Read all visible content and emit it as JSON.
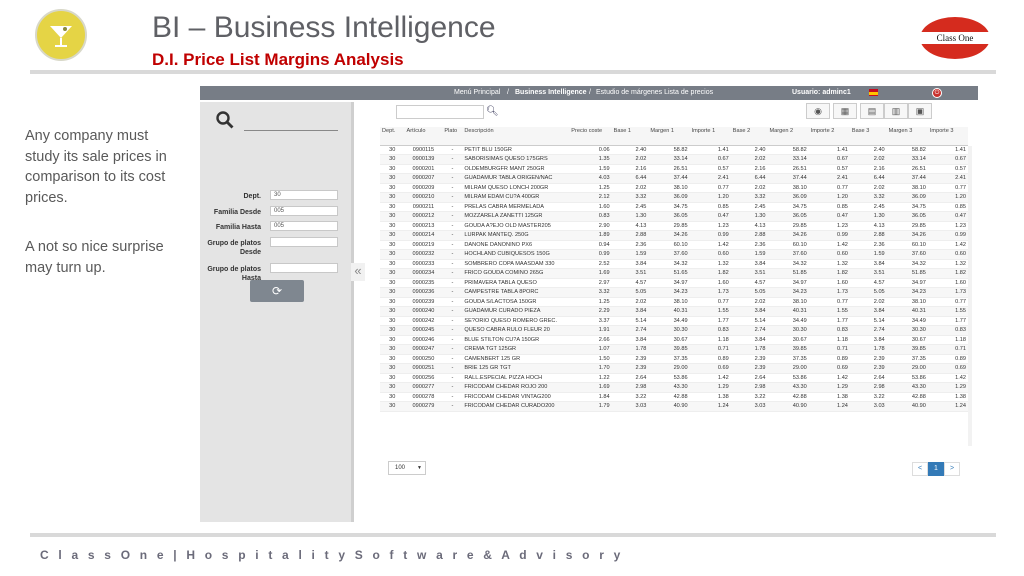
{
  "slide": {
    "title": "BI – Business Intelligence",
    "subtitle": "D.I. Price List Margins Analysis",
    "brand_right": "Class One",
    "side_para1": "Any company must study its sale prices in comparison to its cost prices.",
    "side_para2": "A not so nice surprise may turn up.",
    "footer": "C l a s s O n e | H o s p i t a l i t y S o f t w a r e & A d v i s o r y"
  },
  "app": {
    "breadcrumb": {
      "menu": "Menú Principal",
      "sep": "/",
      "bi": "Business Intelligence",
      "current": "Estudio de márgenes Lista de precios"
    },
    "user": "Usuario: adminc1",
    "filters": {
      "dept_label": "Dept.",
      "dept_value": "30",
      "familia_desde_label": "Familia Desde",
      "familia_desde_value": "005",
      "familia_hasta_label": "Familia Hasta",
      "familia_hasta_value": "005",
      "grupo_desde_label": "Grupo de platos Desde",
      "grupo_hasta_label": "Grupo de platos Hasta"
    },
    "columns": [
      "Dept.",
      "Artículo",
      "Plato",
      "Descripción",
      "Precio coste",
      "Base 1",
      "Margen 1",
      "Importe 1",
      "Base 2",
      "Margen 2",
      "Importe 2",
      "Base 3",
      "Margen 3",
      "Importe 3"
    ],
    "rows": [
      [
        "30",
        "0900115",
        "-",
        "PETIT BLU 150GR",
        "0.06",
        "2.40",
        "58.82",
        "1.41",
        "2.40",
        "58.82",
        "1.41",
        "2.40",
        "58.82",
        "1.41"
      ],
      [
        "30",
        "0900139",
        "-",
        "SABORISIMAS QUESO 175GRS",
        "1.35",
        "2.02",
        "33.14",
        "0.67",
        "2.02",
        "33.14",
        "0.67",
        "2.02",
        "33.14",
        "0.67"
      ],
      [
        "30",
        "0900201",
        "-",
        "OLDEMBURGFR MANT 250GR",
        "1.59",
        "2.16",
        "26.51",
        "0.57",
        "2.16",
        "26.51",
        "0.57",
        "2.16",
        "26.51",
        "0.57"
      ],
      [
        "30",
        "0900207",
        "-",
        "GUADAMUR TABLA ORIGEN/NAC",
        "4.03",
        "6.44",
        "37.44",
        "2.41",
        "6.44",
        "37.44",
        "2.41",
        "6.44",
        "37.44",
        "2.41"
      ],
      [
        "30",
        "0900209",
        "-",
        "MILRAM QUESO LONCH 200GR",
        "1.25",
        "2.02",
        "38.10",
        "0.77",
        "2.02",
        "38.10",
        "0.77",
        "2.02",
        "38.10",
        "0.77"
      ],
      [
        "30",
        "0900210",
        "-",
        "MILRAM EDAM CU?A 400GR",
        "2.12",
        "3.32",
        "36.09",
        "1.20",
        "3.32",
        "36.09",
        "1.20",
        "3.32",
        "36.09",
        "1.20"
      ],
      [
        "30",
        "0900211",
        "-",
        "PRELAS CABRA MERMELADA",
        "1.60",
        "2.45",
        "34.75",
        "0.85",
        "2.45",
        "34.75",
        "0.85",
        "2.45",
        "34.75",
        "0.85"
      ],
      [
        "30",
        "0900212",
        "-",
        "MOZZARELA ZANETTI 125GR",
        "0.83",
        "1.30",
        "36.05",
        "0.47",
        "1.30",
        "36.05",
        "0.47",
        "1.30",
        "36.05",
        "0.47"
      ],
      [
        "30",
        "0900213",
        "-",
        "GOUDA A?EJO OLD MASTER205",
        "2.90",
        "4.13",
        "29.85",
        "1.23",
        "4.13",
        "29.85",
        "1.23",
        "4.13",
        "29.85",
        "1.23"
      ],
      [
        "30",
        "0900214",
        "-",
        "LURPAK MANTEQ. 250G",
        "1.89",
        "2.88",
        "34.26",
        "0.99",
        "2.88",
        "34.26",
        "0.99",
        "2.88",
        "34.26",
        "0.99"
      ],
      [
        "30",
        "0900219",
        "-",
        "DANONE DANONINO PX6",
        "0.94",
        "2.36",
        "60.10",
        "1.42",
        "2.36",
        "60.10",
        "1.42",
        "2.36",
        "60.10",
        "1.42"
      ],
      [
        "30",
        "0900232",
        "-",
        "HOCHLAND CUBIQUESOS 150G",
        "0.99",
        "1.59",
        "37.60",
        "0.60",
        "1.59",
        "37.60",
        "0.60",
        "1.59",
        "37.60",
        "0.60"
      ],
      [
        "30",
        "0900233",
        "-",
        "SOMBRERO COPA MAASDAM 330",
        "2.52",
        "3.84",
        "34.32",
        "1.32",
        "3.84",
        "34.32",
        "1.32",
        "3.84",
        "34.32",
        "1.32"
      ],
      [
        "30",
        "0900234",
        "-",
        "FRICO GOUDA COMINO 265G",
        "1.69",
        "3.51",
        "51.65",
        "1.82",
        "3.51",
        "51.85",
        "1.82",
        "3.51",
        "51.85",
        "1.82"
      ],
      [
        "30",
        "0900235",
        "-",
        "PRIMAVERA TABLA QUESO",
        "2.97",
        "4.57",
        "34.97",
        "1.60",
        "4.57",
        "34.97",
        "1.60",
        "4.57",
        "34.97",
        "1.60"
      ],
      [
        "30",
        "0900236",
        "-",
        "CAMPESTRE TABLA 8PORC",
        "3.32",
        "5.05",
        "34.23",
        "1.73",
        "5.05",
        "34.23",
        "1.73",
        "5.05",
        "34.23",
        "1.73"
      ],
      [
        "30",
        "0900239",
        "-",
        "GOUDA S/LACTOSA 150GR",
        "1.25",
        "2.02",
        "38.10",
        "0.77",
        "2.02",
        "38.10",
        "0.77",
        "2.02",
        "38.10",
        "0.77"
      ],
      [
        "30",
        "0900240",
        "-",
        "GUADAMUR CURADO PIEZA",
        "2.29",
        "3.84",
        "40.31",
        "1.55",
        "3.84",
        "40.31",
        "1.55",
        "3.84",
        "40.31",
        "1.55"
      ],
      [
        "30",
        "0900242",
        "-",
        "SE?ORIO QUESO ROMERO GREC.",
        "3.37",
        "5.14",
        "34.49",
        "1.77",
        "5.14",
        "34.49",
        "1.77",
        "5.14",
        "34.49",
        "1.77"
      ],
      [
        "30",
        "0900245",
        "-",
        "QUESO CABRA RULO FLEUR 20",
        "1.91",
        "2.74",
        "30.30",
        "0.83",
        "2.74",
        "30.30",
        "0.83",
        "2.74",
        "30.30",
        "0.83"
      ],
      [
        "30",
        "0900246",
        "-",
        "BLUE STILTON CU?A 150GR",
        "2.66",
        "3.84",
        "30.67",
        "1.18",
        "3.84",
        "30.67",
        "1.18",
        "3.84",
        "30.67",
        "1.18"
      ],
      [
        "30",
        "0900247",
        "-",
        "CREMA TGT 125GR",
        "1.07",
        "1.78",
        "39.85",
        "0.71",
        "1.78",
        "39.85",
        "0.71",
        "1.78",
        "39.85",
        "0.71"
      ],
      [
        "30",
        "0900250",
        "-",
        "CAMENBERT 125 GR",
        "1.50",
        "2.39",
        "37.35",
        "0.89",
        "2.39",
        "37.35",
        "0.89",
        "2.39",
        "37.35",
        "0.89"
      ],
      [
        "30",
        "0900251",
        "-",
        "BRIE 125 GR TGT",
        "1.70",
        "2.39",
        "29.00",
        "0.69",
        "2.39",
        "29.00",
        "0.69",
        "2.39",
        "29.00",
        "0.69"
      ],
      [
        "30",
        "0900256",
        "-",
        "RALL.ESPECIAL PIZZA HOCH",
        "1.22",
        "2.64",
        "53.86",
        "1.42",
        "2.64",
        "53.86",
        "1.42",
        "2.64",
        "53.86",
        "1.42"
      ],
      [
        "30",
        "0900277",
        "-",
        "FRICODAM CHEDAR ROJO 200",
        "1.69",
        "2.98",
        "43.30",
        "1.29",
        "2.98",
        "43.30",
        "1.29",
        "2.98",
        "43.30",
        "1.29"
      ],
      [
        "30",
        "0900278",
        "-",
        "FRICODAM CHEDAR VINTAG200",
        "1.84",
        "3.22",
        "42.88",
        "1.38",
        "3.22",
        "42.88",
        "1.38",
        "3.22",
        "42.88",
        "1.38"
      ],
      [
        "30",
        "0900279",
        "-",
        "FRICODAM CHEDAR CURADO200",
        "1.79",
        "3.03",
        "40.90",
        "1.24",
        "3.03",
        "40.90",
        "1.24",
        "3.03",
        "40.90",
        "1.24"
      ]
    ],
    "page_size": "100",
    "pager": {
      "prev": "<",
      "current": "1",
      "next": ">"
    }
  }
}
